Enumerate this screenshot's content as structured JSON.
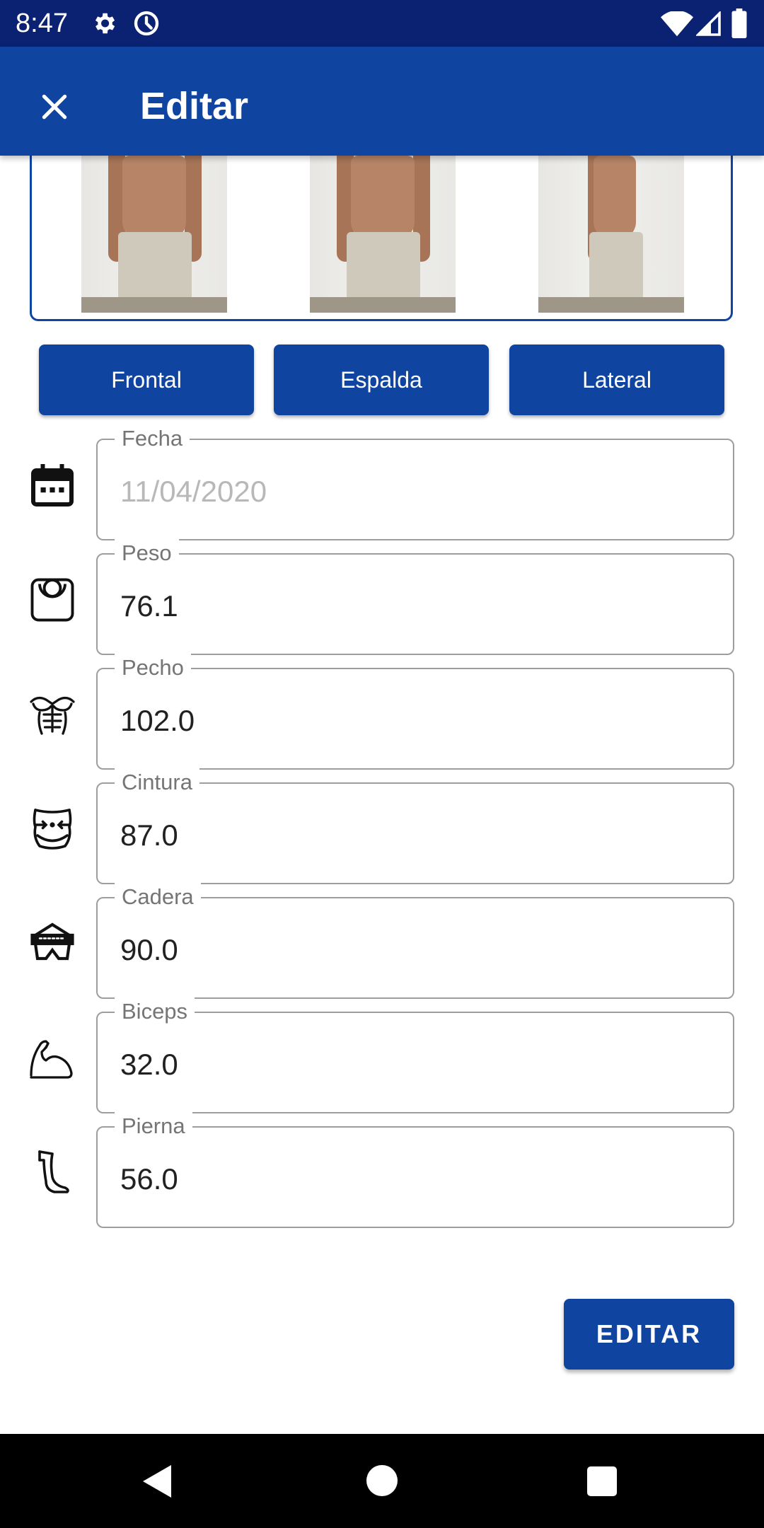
{
  "status_bar": {
    "time": "8:47",
    "icons": [
      "gear-icon",
      "data-saver-icon",
      "wifi-icon",
      "signal-icon",
      "battery-icon"
    ]
  },
  "app_bar": {
    "title": "Editar",
    "close_icon": "close-icon"
  },
  "colors": {
    "primary": "#0f44a0",
    "status_bar": "#0b2272",
    "field_border": "#9e9e9e",
    "label": "#757575",
    "disabled_text": "#b8b8b8"
  },
  "photos": {
    "buttons": {
      "front_label": "Frontal",
      "back_label": "Espalda",
      "side_label": "Lateral"
    }
  },
  "fields": {
    "fecha": {
      "label": "Fecha",
      "value": "11/04/2020",
      "icon": "calendar-icon",
      "disabled": true
    },
    "peso": {
      "label": "Peso",
      "value": "76.1",
      "icon": "scale-icon"
    },
    "pecho": {
      "label": "Pecho",
      "value": "102.0",
      "icon": "chest-icon"
    },
    "cintura": {
      "label": "Cintura",
      "value": "87.0",
      "icon": "waist-icon"
    },
    "cadera": {
      "label": "Cadera",
      "value": "90.0",
      "icon": "hip-icon"
    },
    "biceps": {
      "label": "Biceps",
      "value": "32.0",
      "icon": "bicep-icon"
    },
    "pierna": {
      "label": "Pierna",
      "value": "56.0",
      "icon": "leg-icon"
    }
  },
  "submit": {
    "label": "EDITAR"
  },
  "nav_bar": {
    "icons": [
      "back-icon",
      "home-icon",
      "recents-icon"
    ]
  }
}
